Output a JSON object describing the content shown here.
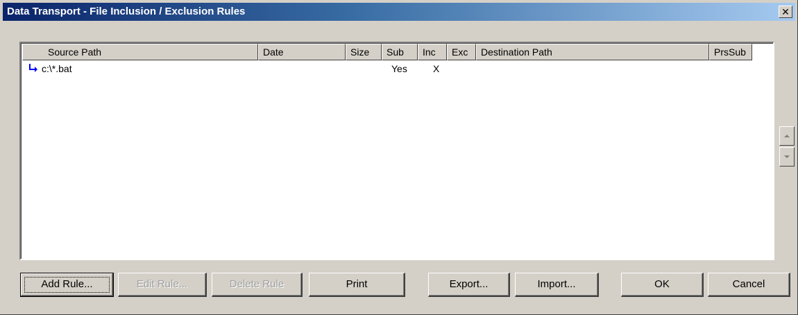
{
  "window": {
    "title": "Data Transport - File Inclusion / Exclusion Rules",
    "close_label": "✕"
  },
  "table": {
    "columns": [
      "Source Path",
      "Date",
      "Size",
      "Sub",
      "Inc",
      "Exc",
      "Destination Path",
      "PrsSub"
    ],
    "rows": [
      {
        "icon": "arrow-return-icon",
        "source_path": "c:\\*.bat",
        "date": "",
        "size": "",
        "sub": "Yes",
        "inc": "X",
        "exc": "",
        "destination_path": "",
        "prssub": ""
      }
    ]
  },
  "buttons": {
    "add_rule": "Add Rule...",
    "edit_rule": "Edit Rule...",
    "delete_rule": "Delete Rule",
    "print": "Print",
    "export": "Export...",
    "import": "Import...",
    "ok": "OK",
    "cancel": "Cancel"
  },
  "colors": {
    "title_gradient_start": "#0a246a",
    "title_gradient_end": "#a6caf0",
    "face": "#d4d0c8",
    "arrow": "#0000ff"
  }
}
